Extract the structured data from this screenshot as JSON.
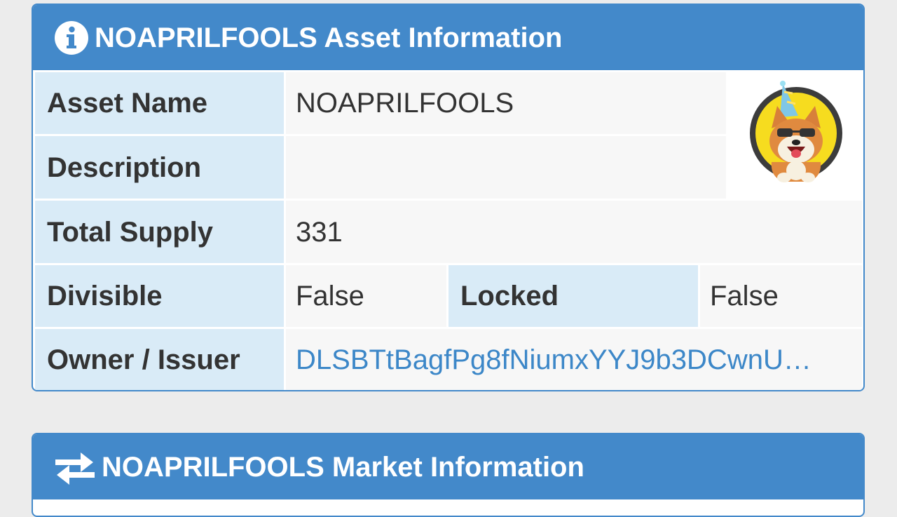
{
  "asset_panel": {
    "title": "NOAPRILFOOLS Asset Information",
    "icon": "info-circle-icon",
    "rows": {
      "asset_name": {
        "label": "Asset Name",
        "value": "NOAPRILFOOLS"
      },
      "description": {
        "label": "Description",
        "value": ""
      },
      "total_supply": {
        "label": "Total Supply",
        "value": "331"
      },
      "divisible": {
        "label": "Divisible",
        "value": "False"
      },
      "locked": {
        "label": "Locked",
        "value": "False"
      },
      "owner": {
        "label": "Owner / Issuer",
        "value": "DLSBTtBagfPg8fNiumxYYJ9b3DCwnU…"
      }
    },
    "avatar": "shiba-dog-party-hat-avatar"
  },
  "market_panel": {
    "title": "NOAPRILFOOLS Market Information",
    "icon": "exchange-arrows-icon"
  },
  "colors": {
    "header_blue": "#4389ca",
    "label_bg": "#d9ebf7",
    "value_bg": "#f7f7f7",
    "link": "#3c87c8"
  }
}
